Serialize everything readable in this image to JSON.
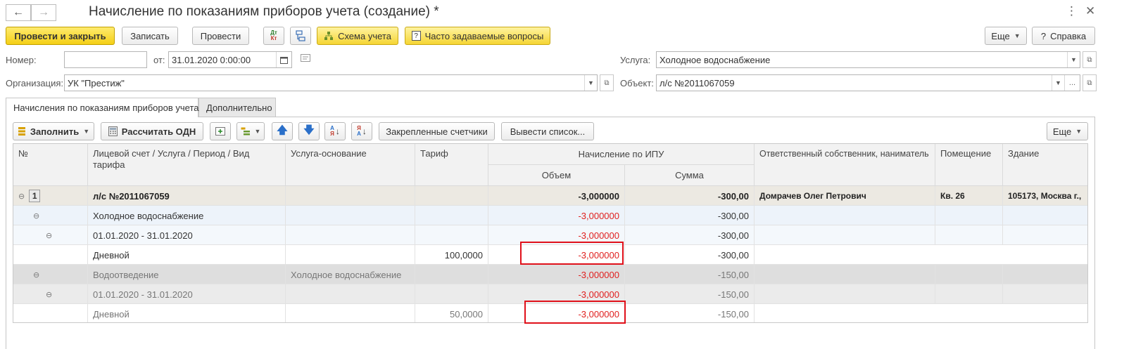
{
  "window": {
    "title": "Начисление по показаниям приборов учета (создание) *"
  },
  "toolbar": {
    "post_close": "Провести и закрыть",
    "save": "Записать",
    "post": "Провести",
    "account_scheme": "Схема учета",
    "faq": "Часто задаваемые вопросы",
    "more": "Еще",
    "help": "Справка"
  },
  "header": {
    "number_label": "Номер:",
    "number_value": "",
    "date_label": "от:",
    "date_value": "31.01.2020  0:00:00",
    "org_label": "Организация:",
    "org_value": "УК \"Престиж\"",
    "service_label": "Услуга:",
    "service_value": "Холодное водоснабжение",
    "object_label": "Объект:",
    "object_value": "л/с №2011067059"
  },
  "tabs": [
    {
      "label": "Начисления по показаниям приборов учета",
      "active": true
    },
    {
      "label": "Дополнительно",
      "active": false
    }
  ],
  "table_toolbar": {
    "fill": "Заполнить",
    "calc_odn": "Рассчитать ОДН",
    "fixed_counters": "Закрепленные счетчики",
    "print_list": "Вывести список...",
    "more": "Еще"
  },
  "table": {
    "columns": {
      "num": "№",
      "account": "Лицевой счет / Услуга / Период / Вид тарифа",
      "base_service": "Услуга-основание",
      "tariff": "Тариф",
      "ipu_group": "Начисление по ИПУ",
      "volume": "Объем",
      "sum": "Сумма",
      "owner": "Ответственный собственник, наниматель",
      "room": "Помещение",
      "building": "Здание"
    },
    "rows": [
      {
        "num": "1",
        "name": "л/с №2011067059",
        "base": "",
        "tariff": "",
        "volume": "-3,000000",
        "sum": "-300,00",
        "owner": "Домрачев Олег Петрович",
        "room": "Кв. 26",
        "building": "105173, Москва г.,"
      },
      {
        "num": "",
        "name": "Холодное водоснабжение",
        "base": "",
        "tariff": "",
        "volume": "-3,000000",
        "sum": "-300,00",
        "owner": "",
        "room": "",
        "building": ""
      },
      {
        "num": "",
        "name": "01.01.2020 - 31.01.2020",
        "base": "",
        "tariff": "",
        "volume": "-3,000000",
        "sum": "-300,00",
        "owner": "",
        "room": "",
        "building": ""
      },
      {
        "num": "",
        "name": "Дневной",
        "base": "",
        "tariff": "100,0000",
        "volume": "-3,000000",
        "sum": "-300,00",
        "owner": "",
        "room": "",
        "building": ""
      },
      {
        "num": "",
        "name": "Водоотведение",
        "base": "Холодное водоснабжение",
        "tariff": "",
        "volume": "-3,000000",
        "sum": "-150,00",
        "owner": "",
        "room": "",
        "building": ""
      },
      {
        "num": "",
        "name": "01.01.2020 - 31.01.2020",
        "base": "",
        "tariff": "",
        "volume": "-3,000000",
        "sum": "-150,00",
        "owner": "",
        "room": "",
        "building": ""
      },
      {
        "num": "",
        "name": "Дневной",
        "base": "",
        "tariff": "50,0000",
        "volume": "-3,000000",
        "sum": "-150,00",
        "owner": "",
        "room": "",
        "building": ""
      }
    ]
  },
  "colors": {
    "accent_yellow": "#f4cf16",
    "negative": "#e0201f",
    "highlight": "#e0101a"
  }
}
